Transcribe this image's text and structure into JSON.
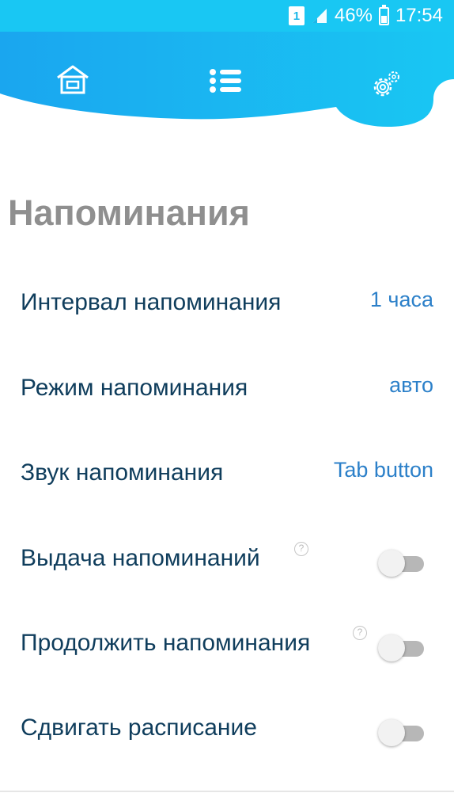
{
  "status_bar": {
    "sim_label": "1",
    "battery_text": "46%",
    "battery_level": 0.46,
    "time": "17:54"
  },
  "nav": {
    "tabs": [
      {
        "icon": "home-icon",
        "active": false
      },
      {
        "icon": "list-icon",
        "active": false
      },
      {
        "icon": "gear-icon",
        "active": true
      }
    ]
  },
  "page": {
    "title": "Напоминания"
  },
  "settings": {
    "items": [
      {
        "label": "Интервал напоминания",
        "value": "1 часа"
      },
      {
        "label": "Режим напоминания",
        "value": "авто"
      },
      {
        "label": "Звук напоминания",
        "value": "Tab button"
      },
      {
        "label": "Выдача напоминаний",
        "toggle": false,
        "has_help": true
      },
      {
        "label": "Продолжить напоминания",
        "toggle": false,
        "has_help": true
      },
      {
        "label": "Сдвигать расписание",
        "toggle": false
      }
    ],
    "help_glyph": "?"
  },
  "colors": {
    "header_start": "#1ab7e8",
    "header_end": "#3aa6f5",
    "label": "#0f3d5c",
    "value": "#2c80c9",
    "title": "#8f8f8f"
  }
}
